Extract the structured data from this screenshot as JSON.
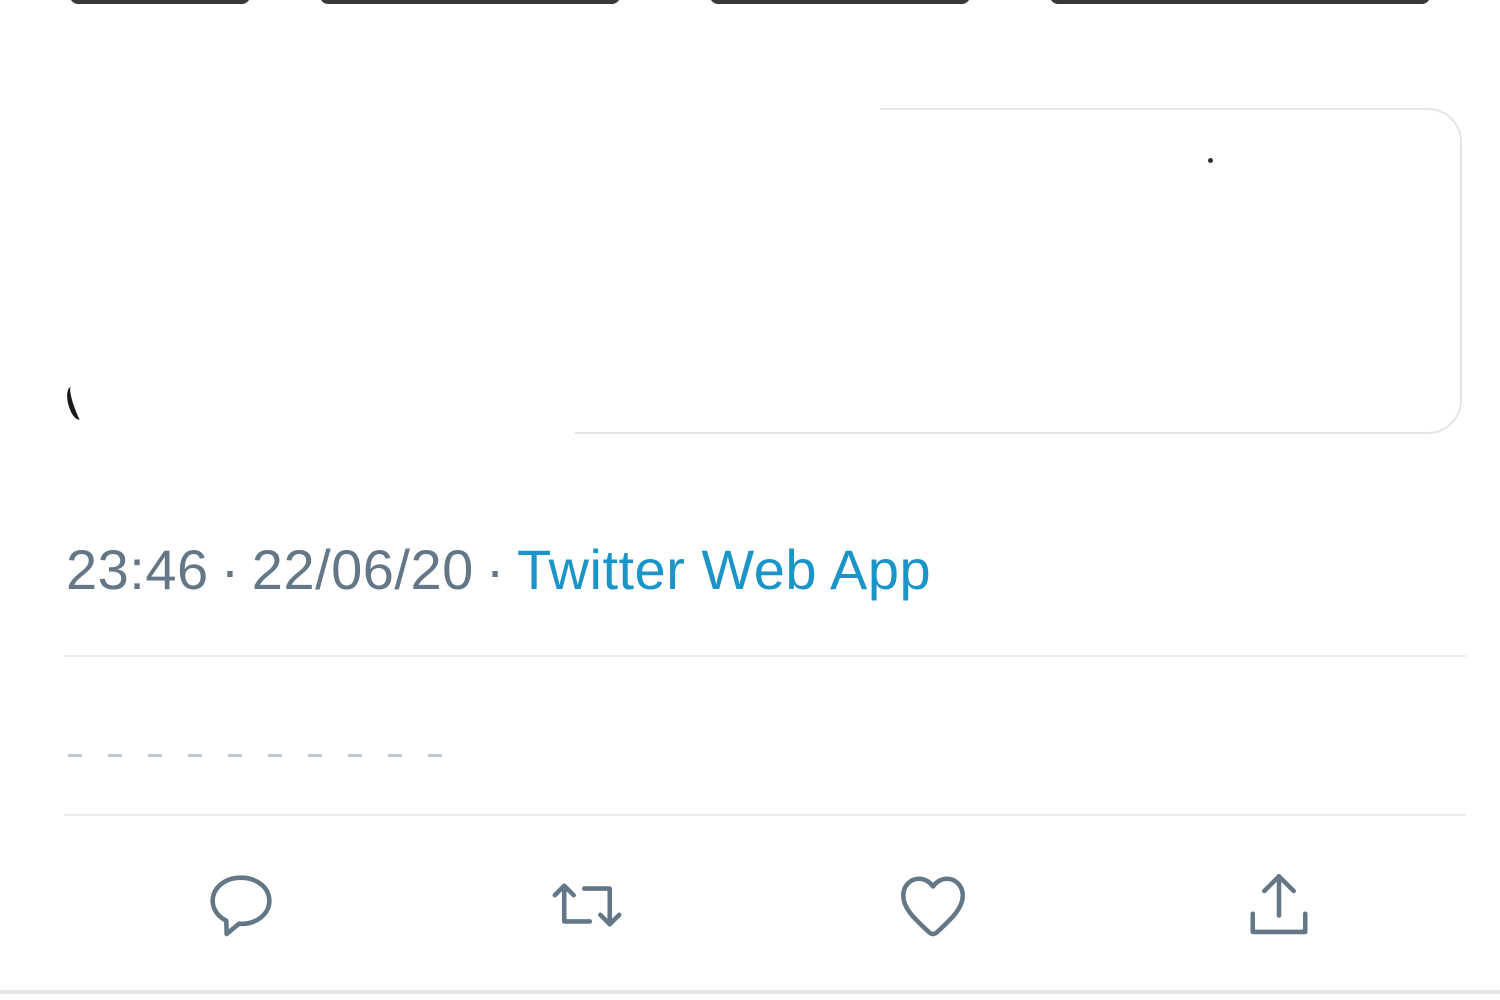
{
  "tweet": {
    "time": "23:46",
    "date": "22/06/20",
    "separator": "·",
    "source": "Twitter Web App"
  },
  "colors": {
    "meta_text": "#657786",
    "source_link": "#1b95c8",
    "icon": "#657786",
    "divider": "#e8ebee"
  },
  "actions": [
    {
      "name": "reply",
      "icon": "speech-bubble-icon"
    },
    {
      "name": "retweet",
      "icon": "retweet-arrows-icon"
    },
    {
      "name": "like",
      "icon": "heart-icon"
    },
    {
      "name": "share",
      "icon": "upload-share-icon"
    }
  ]
}
